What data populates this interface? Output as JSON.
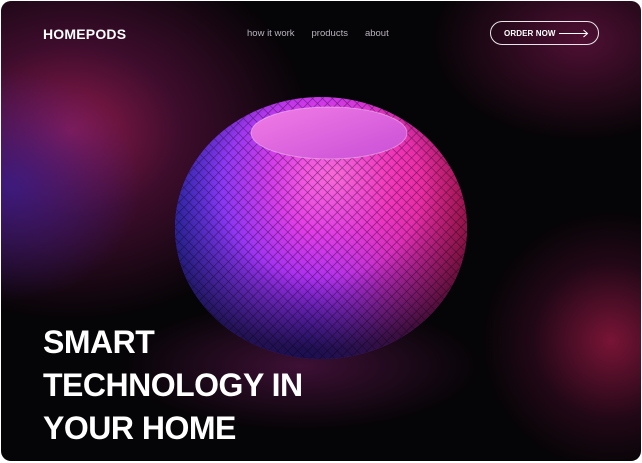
{
  "brand": {
    "logo_text": "HOMEPODS"
  },
  "nav": {
    "links": [
      {
        "label": "how it work"
      },
      {
        "label": "products"
      },
      {
        "label": "about"
      }
    ]
  },
  "cta": {
    "label": "ORDER NOW",
    "icon": "arrow-right-icon"
  },
  "hero": {
    "headline_lines": [
      "SMART",
      "TECHNOLOGY IN",
      "YOUR HOME"
    ],
    "image": "smart-speaker-image"
  },
  "colors": {
    "background": "#050406",
    "text": "#ffffff",
    "nav_link": "#b9b4bf",
    "accent_pink": "#ff2a7a",
    "accent_violet": "#c060ff",
    "accent_blue": "#3a3dff"
  }
}
